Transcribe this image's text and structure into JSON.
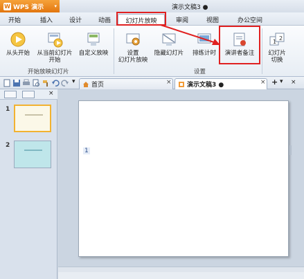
{
  "app": {
    "name": "WPS 演示",
    "logo": "W"
  },
  "document_title": "演示文稿3 ●",
  "menu_tabs": [
    "开始",
    "插入",
    "设计",
    "动画",
    "幻灯片放映",
    "审阅",
    "视图",
    "办公空间"
  ],
  "active_menu_tab": "幻灯片放映",
  "ribbon": {
    "buttons": [
      {
        "label": "从头开始",
        "icon": "play-icon"
      },
      {
        "label": "从当前幻灯片\n开始",
        "icon": "play-current-icon"
      },
      {
        "label": "自定义放映",
        "icon": "custom-show-icon"
      },
      {
        "label": "设置\n幻灯片放映",
        "icon": "setup-show-icon"
      },
      {
        "label": "隐藏幻灯片",
        "icon": "hide-slide-icon"
      },
      {
        "label": "排练计时",
        "icon": "rehearse-timing-icon"
      },
      {
        "label": "演讲者备注",
        "icon": "speaker-notes-icon"
      },
      {
        "label": "幻灯片\n切换",
        "icon": "slide-transition-icon"
      }
    ],
    "group_labels": [
      "开始放映幻灯片",
      "设置"
    ]
  },
  "doc_tabs": [
    {
      "label": "首页",
      "icon": "home-icon",
      "active": false
    },
    {
      "label": "演示文稿3 ●",
      "icon": "doc-icon",
      "active": true
    }
  ],
  "tab_controls": {
    "close": "×",
    "add": "+",
    "dropdown": "▾"
  },
  "slides_panel": {
    "thumbnails": [
      {
        "number": "1",
        "selected": true
      },
      {
        "number": "2",
        "selected": false
      }
    ]
  },
  "slide_marker": "1",
  "colors": {
    "highlight": "#e02020",
    "app_orange": "#e2760f",
    "thumb2": "#bfe6ea"
  }
}
